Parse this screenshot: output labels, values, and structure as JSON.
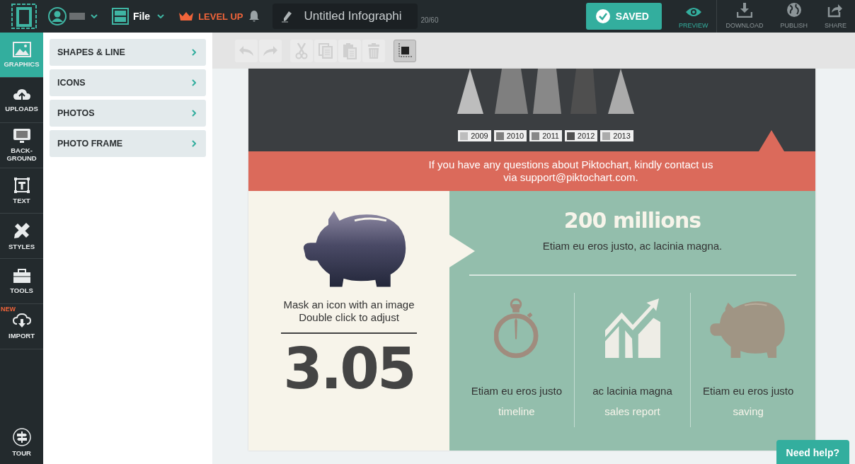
{
  "topbar": {
    "file_label": "File",
    "level_up": "LEVEL UP",
    "title": "Untitled Infographi",
    "counter": "20/60",
    "saved": "SAVED",
    "actions": [
      {
        "label": "PREVIEW",
        "selected": true
      },
      {
        "label": "DOWNLOAD",
        "selected": false
      },
      {
        "label": "PUBLISH",
        "selected": false
      },
      {
        "label": "SHARE",
        "selected": false
      }
    ]
  },
  "rail": {
    "items": [
      {
        "label": "GRAPHICS",
        "selected": true
      },
      {
        "label": "UPLOADS",
        "selected": false
      },
      {
        "label": "BACK-GROUND",
        "selected": false
      },
      {
        "label": "TEXT",
        "selected": false
      },
      {
        "label": "STYLES",
        "selected": false
      },
      {
        "label": "TOOLS",
        "selected": false
      },
      {
        "label": "IMPORT",
        "selected": false,
        "badge": "NEW"
      }
    ],
    "tour": "TOUR"
  },
  "panel": {
    "items": [
      {
        "label": "SHAPES & LINE"
      },
      {
        "label": "ICONS"
      },
      {
        "label": "PHOTOS"
      },
      {
        "label": "PHOTO FRAME"
      }
    ]
  },
  "toolbar": {
    "tools": [
      {
        "kind": "undo",
        "disabled": true
      },
      {
        "kind": "redo",
        "disabled": true
      },
      {
        "kind": "cut",
        "disabled": true
      },
      {
        "kind": "copy",
        "disabled": true
      },
      {
        "kind": "paste",
        "disabled": true
      },
      {
        "kind": "delete",
        "disabled": true
      },
      {
        "kind": "arrange",
        "disabled": false
      }
    ]
  },
  "infographic": {
    "legend": [
      {
        "label": "2009",
        "color": "#bdbdbd"
      },
      {
        "label": "2010",
        "color": "#7f7f7f"
      },
      {
        "label": "2011",
        "color": "#888888"
      },
      {
        "label": "2012",
        "color": "#4f4f4f"
      },
      {
        "label": "2013",
        "color": "#ababab"
      }
    ],
    "banner": "If you have any questions about Piktochart, kindly contact us\nvia support@piktochart.com.",
    "mask_caption": "Mask an icon with an image\nDouble click to adjust",
    "big_number": "3.05",
    "headline": "200 millions",
    "subhead": "Etiam eu eros justo, ac lacinia magna.",
    "columns": [
      {
        "text": "Etiam eu eros justo",
        "caption": "timeline"
      },
      {
        "text": "ac lacinia magna",
        "caption": "sales report"
      },
      {
        "text": "Etiam eu eros justo",
        "caption": "saving"
      }
    ]
  },
  "help_button": "Need help?"
}
